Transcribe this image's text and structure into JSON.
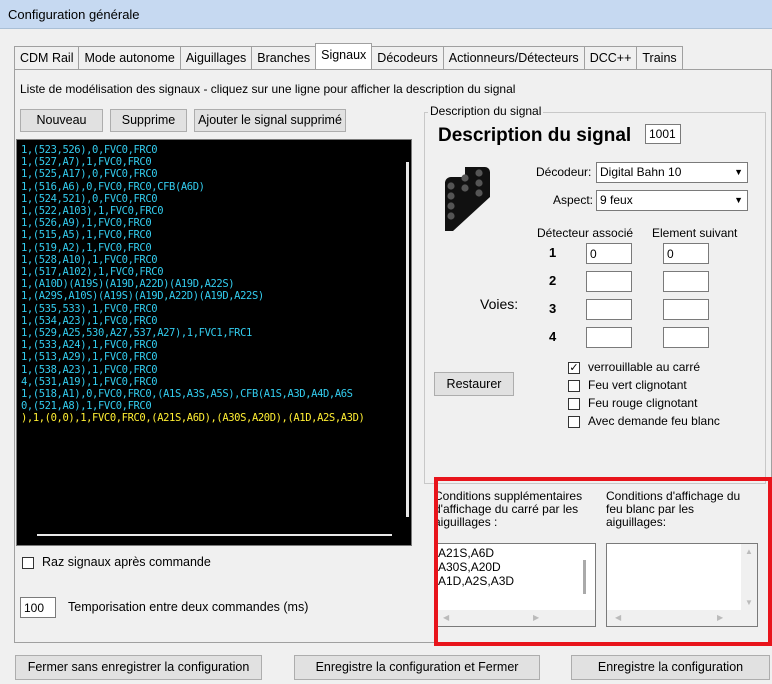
{
  "window": {
    "title": "Configuration générale"
  },
  "tabs": [
    "CDM Rail",
    "Mode autonome",
    "Aiguillages",
    "Branches",
    "Signaux",
    "Décodeurs",
    "Actionneurs/Détecteurs",
    "DCC++",
    "Trains"
  ],
  "active_tab": "Signaux",
  "list_caption": "Liste de modélisation des signaux - cliquez sur une ligne pour afficher la description du signal",
  "buttons": {
    "nouveau": "Nouveau",
    "supprime": "Supprime",
    "ajouter": "Ajouter le signal supprimé",
    "restaurer": "Restaurer",
    "fermer": "Fermer sans enregistrer la configuration",
    "enregistre_fermer": "Enregistre la configuration et Fermer",
    "enregistre": "Enregistre la configuration"
  },
  "signal_lines": [
    {
      "text": "1,(523,526),0,FVC0,FRC0",
      "color": "#33ccee"
    },
    {
      "text": "1,(527,A7),1,FVC0,FRC0",
      "color": "#33ccee"
    },
    {
      "text": "1,(525,A17),0,FVC0,FRC0",
      "color": "#33ccee"
    },
    {
      "text": "1,(516,A6),0,FVC0,FRC0,CFB(A6D)",
      "color": "#33ccee"
    },
    {
      "text": "1,(524,521),0,FVC0,FRC0",
      "color": "#33ccee"
    },
    {
      "text": "1,(522,A103),1,FVC0,FRC0",
      "color": "#33ccee"
    },
    {
      "text": "1,(526,A9),1,FVC0,FRC0",
      "color": "#33ccee"
    },
    {
      "text": "1,(515,A5),1,FVC0,FRC0",
      "color": "#33ccee"
    },
    {
      "text": "1,(519,A2),1,FVC0,FRC0",
      "color": "#33ccee"
    },
    {
      "text": "1,(528,A10),1,FVC0,FRC0",
      "color": "#33ccee"
    },
    {
      "text": "1,(517,A102),1,FVC0,FRC0",
      "color": "#33ccee"
    },
    {
      "text": "1,(A10D)(A19S)(A19D,A22D)(A19D,A22S)",
      "color": "#33ccee"
    },
    {
      "text": "1,(A29S,A10S)(A19S)(A19D,A22D)(A19D,A22S)",
      "color": "#33ccee"
    },
    {
      "text": "1,(535,533),1,FVC0,FRC0",
      "color": "#33ccee"
    },
    {
      "text": "1,(534,A23),1,FVC0,FRC0",
      "color": "#33ccee"
    },
    {
      "text": "1,(529,A25,530,A27,537,A27),1,FVC1,FRC1",
      "color": "#33ccee"
    },
    {
      "text": "1,(533,A24),1,FVC0,FRC0",
      "color": "#33ccee"
    },
    {
      "text": "1,(513,A29),1,FVC0,FRC0",
      "color": "#33ccee"
    },
    {
      "text": "1,(538,A23),1,FVC0,FRC0",
      "color": "#33ccee"
    },
    {
      "text": "4,(531,A19),1,FVC0,FRC0",
      "color": "#33ccee"
    },
    {
      "text": "1,(518,A1),0,FVC0,FRC0,(A1S,A3S,A5S),CFB(A1S,A3D,A4D,A6S",
      "color": "#33ccee"
    },
    {
      "text": "0,(521,A8),1,FVC0,FRC0",
      "color": "#33ccee"
    },
    {
      "text": "),1,(0,0),1,FVC0,FRC0,(A21S,A6D),(A30S,A20D),(A1D,A2S,A3D)",
      "color": "#ffee33"
    }
  ],
  "raz_label": "Raz signaux après commande",
  "temporisation": {
    "value": "100",
    "label": "Temporisation entre deux commandes (ms)"
  },
  "description": {
    "group_label": "Description du signal",
    "heading": "Description du signal",
    "number": "1001",
    "decodeur_label": "Décodeur:",
    "decodeur_value": "Digital Bahn 10",
    "aspect_label": "Aspect:",
    "aspect_value": "9 feux",
    "detecteur_header": "Détecteur associé",
    "element_header": "Element suivant",
    "voies_label": "Voies:",
    "voie_numbers": [
      "1",
      "2",
      "3",
      "4"
    ],
    "detecteurs": [
      "0",
      "",
      "",
      ""
    ],
    "elements": [
      "0",
      "",
      "",
      ""
    ],
    "checkboxes": [
      {
        "label": "verrouillable au carré",
        "checked": true
      },
      {
        "label": "Feu vert clignotant",
        "checked": false
      },
      {
        "label": "Feu rouge clignotant",
        "checked": false
      },
      {
        "label": "Avec demande feu blanc",
        "checked": false
      }
    ],
    "cond_carre_label": "Conditions supplémentaires d'affichage du carré par les aiguillages :",
    "cond_carre_lines": [
      "A21S,A6D",
      "A30S,A20D",
      "A1D,A2S,A3D"
    ],
    "cond_blanc_label": "Conditions d'affichage du feu blanc par les aiguillages:",
    "highlight_color": "#e8141b"
  }
}
